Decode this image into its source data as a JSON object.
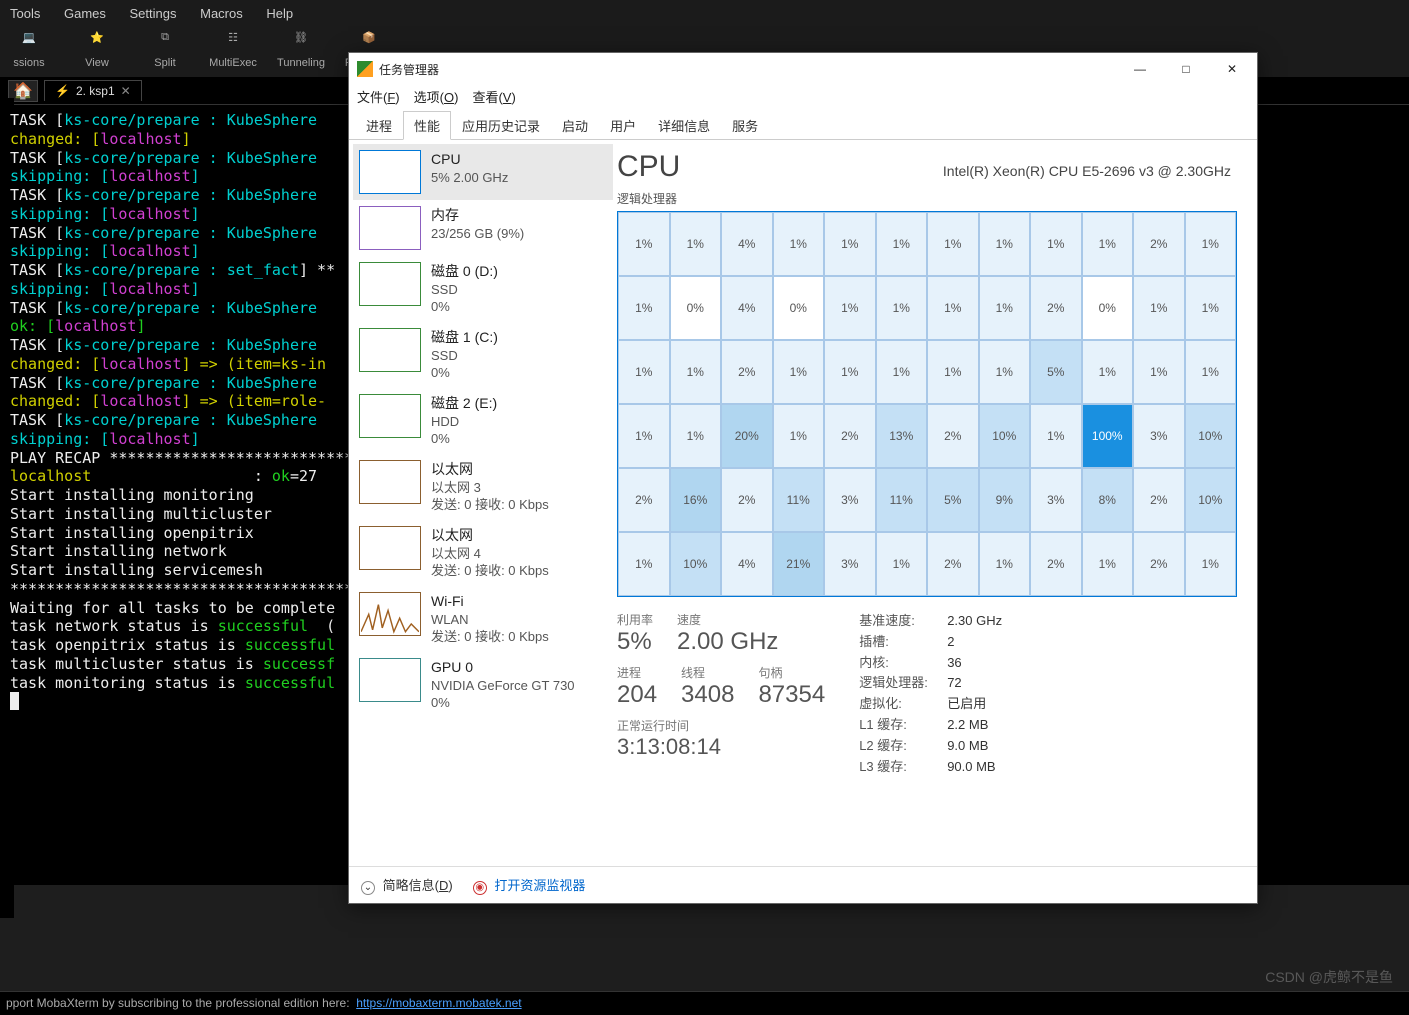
{
  "moba": {
    "menus": [
      "Tools",
      "Games",
      "Settings",
      "Macros",
      "Help"
    ],
    "toolbar": [
      "ssions",
      "View",
      "Split",
      "MultiExec",
      "Tunneling",
      "Packages"
    ],
    "tab": {
      "label": "2. ksp1"
    },
    "terminal_lines": [
      {
        "segs": [
          [
            "",
            ""
          ]
        ]
      },
      {
        "segs": [
          [
            "white",
            "TASK ["
          ],
          [
            "cyan",
            "ks-core/prepare : KubeSphere"
          ],
          [
            "white",
            ""
          ]
        ]
      },
      {
        "segs": [
          [
            "yellow",
            "changed: ["
          ],
          [
            "magenta",
            "localhost"
          ],
          [
            "yellow",
            "]"
          ]
        ]
      },
      {
        "segs": [
          [
            "",
            ""
          ]
        ]
      },
      {
        "segs": [
          [
            "white",
            "TASK ["
          ],
          [
            "cyan",
            "ks-core/prepare : KubeSphere"
          ],
          [
            "white",
            ""
          ]
        ]
      },
      {
        "segs": [
          [
            "cyan",
            "skipping: ["
          ],
          [
            "magenta",
            "localhost"
          ],
          [
            "cyan",
            "]"
          ]
        ]
      },
      {
        "segs": [
          [
            "",
            ""
          ]
        ]
      },
      {
        "segs": [
          [
            "white",
            "TASK ["
          ],
          [
            "cyan",
            "ks-core/prepare : KubeSphere"
          ],
          [
            "white",
            ""
          ]
        ]
      },
      {
        "segs": [
          [
            "cyan",
            "skipping: ["
          ],
          [
            "magenta",
            "localhost"
          ],
          [
            "cyan",
            "]"
          ]
        ]
      },
      {
        "segs": [
          [
            "",
            ""
          ]
        ]
      },
      {
        "segs": [
          [
            "white",
            "TASK ["
          ],
          [
            "cyan",
            "ks-core/prepare : KubeSphere"
          ],
          [
            "white",
            ""
          ]
        ]
      },
      {
        "segs": [
          [
            "cyan",
            "skipping: ["
          ],
          [
            "magenta",
            "localhost"
          ],
          [
            "cyan",
            "]"
          ]
        ]
      },
      {
        "segs": [
          [
            "",
            ""
          ]
        ]
      },
      {
        "segs": [
          [
            "white",
            "TASK ["
          ],
          [
            "cyan",
            "ks-core/prepare : set_fact"
          ],
          [
            "white",
            "] **"
          ]
        ]
      },
      {
        "segs": [
          [
            "cyan",
            "skipping: ["
          ],
          [
            "magenta",
            "localhost"
          ],
          [
            "cyan",
            "]"
          ]
        ]
      },
      {
        "segs": [
          [
            "",
            ""
          ]
        ]
      },
      {
        "segs": [
          [
            "white",
            "TASK ["
          ],
          [
            "cyan",
            "ks-core/prepare : KubeSphere"
          ],
          [
            "white",
            ""
          ]
        ]
      },
      {
        "segs": [
          [
            "green",
            "ok: ["
          ],
          [
            "magenta",
            "localhost"
          ],
          [
            "green",
            "]"
          ]
        ]
      },
      {
        "segs": [
          [
            "",
            ""
          ]
        ]
      },
      {
        "segs": [
          [
            "white",
            "TASK ["
          ],
          [
            "cyan",
            "ks-core/prepare : KubeSphere"
          ],
          [
            "white",
            ""
          ]
        ]
      },
      {
        "segs": [
          [
            "yellow",
            "changed: ["
          ],
          [
            "magenta",
            "localhost"
          ],
          [
            "yellow",
            "] => (item=ks-in"
          ]
        ]
      },
      {
        "segs": [
          [
            "",
            ""
          ]
        ]
      },
      {
        "segs": [
          [
            "white",
            "TASK ["
          ],
          [
            "cyan",
            "ks-core/prepare : KubeSphere"
          ],
          [
            "white",
            ""
          ]
        ]
      },
      {
        "segs": [
          [
            "yellow",
            "changed: ["
          ],
          [
            "magenta",
            "localhost"
          ],
          [
            "yellow",
            "] => (item=role-"
          ]
        ]
      },
      {
        "segs": [
          [
            "",
            ""
          ]
        ]
      },
      {
        "segs": [
          [
            "white",
            "TASK ["
          ],
          [
            "cyan",
            "ks-core/prepare : KubeSphere"
          ],
          [
            "white",
            ""
          ]
        ]
      },
      {
        "segs": [
          [
            "cyan",
            "skipping: ["
          ],
          [
            "magenta",
            "localhost"
          ],
          [
            "cyan",
            "]"
          ]
        ]
      },
      {
        "segs": [
          [
            "",
            ""
          ]
        ]
      },
      {
        "segs": [
          [
            "white",
            "PLAY RECAP *****************************"
          ]
        ]
      },
      {
        "segs": [
          [
            "yellow",
            "localhost"
          ],
          [
            "white",
            "                  : "
          ],
          [
            "green",
            "ok"
          ],
          [
            "white",
            "=27"
          ]
        ]
      },
      {
        "segs": [
          [
            "white",
            "Start installing monitoring"
          ]
        ]
      },
      {
        "segs": [
          [
            "white",
            "Start installing multicluster"
          ]
        ]
      },
      {
        "segs": [
          [
            "white",
            "Start installing openpitrix"
          ]
        ]
      },
      {
        "segs": [
          [
            "white",
            "Start installing network"
          ]
        ]
      },
      {
        "segs": [
          [
            "white",
            "Start installing servicemesh"
          ]
        ]
      },
      {
        "segs": [
          [
            "white",
            "****************************************"
          ]
        ]
      },
      {
        "segs": [
          [
            "white",
            "Waiting for all tasks to be complete"
          ]
        ]
      },
      {
        "segs": [
          [
            "white",
            "task network status is "
          ],
          [
            "green",
            "successful"
          ],
          [
            "white",
            "  ("
          ]
        ]
      },
      {
        "segs": [
          [
            "white",
            "task openpitrix status is "
          ],
          [
            "green",
            "successful"
          ]
        ]
      },
      {
        "segs": [
          [
            "white",
            "task multicluster status is "
          ],
          [
            "green",
            "successf"
          ]
        ]
      },
      {
        "segs": [
          [
            "white",
            "task monitoring status is "
          ],
          [
            "green",
            "successful"
          ]
        ]
      }
    ],
    "statusbar_text": "pport MobaXterm by subscribing to the professional edition here:",
    "statusbar_link": "https://mobaxterm.mobatek.net"
  },
  "tm": {
    "title": "任务管理器",
    "winbtns": {
      "min": "—",
      "max": "□",
      "close": "✕"
    },
    "menus": [
      {
        "label": "文件",
        "hotkey": "F"
      },
      {
        "label": "选项",
        "hotkey": "O"
      },
      {
        "label": "查看",
        "hotkey": "V"
      }
    ],
    "tabs": [
      "进程",
      "性能",
      "应用历史记录",
      "启动",
      "用户",
      "详细信息",
      "服务"
    ],
    "active_tab": 1,
    "sidebar": [
      {
        "kind": "cpu",
        "title": "CPU",
        "sub": "5% 2.00 GHz",
        "active": true
      },
      {
        "kind": "mem",
        "title": "内存",
        "sub": "23/256 GB (9%)"
      },
      {
        "kind": "disk",
        "title": "磁盘 0 (D:)",
        "sub": "SSD",
        "sub2": "0%"
      },
      {
        "kind": "disk",
        "title": "磁盘 1 (C:)",
        "sub": "SSD",
        "sub2": "0%"
      },
      {
        "kind": "disk",
        "title": "磁盘 2 (E:)",
        "sub": "HDD",
        "sub2": "0%"
      },
      {
        "kind": "net",
        "title": "以太网",
        "sub": "以太网 3",
        "sub2": "发送: 0 接收: 0 Kbps"
      },
      {
        "kind": "net",
        "title": "以太网",
        "sub": "以太网 4",
        "sub2": "发送: 0 接收: 0 Kbps"
      },
      {
        "kind": "wifi",
        "title": "Wi-Fi",
        "sub": "WLAN",
        "sub2": "发送: 0 接收: 0 Kbps"
      },
      {
        "kind": "gpu",
        "title": "GPU 0",
        "sub": "NVIDIA GeForce GT 730",
        "sub2": "0%"
      }
    ],
    "main": {
      "heading": "CPU",
      "model": "Intel(R) Xeon(R) CPU E5-2696 v3 @ 2.30GHz",
      "subheader": "逻辑处理器",
      "cells": [
        [
          "1%",
          "1%",
          "4%",
          "1%",
          "1%",
          "1%",
          "1%",
          "1%",
          "1%",
          "1%",
          "2%",
          "1%"
        ],
        [
          "1%",
          "0%",
          "4%",
          "0%",
          "1%",
          "1%",
          "1%",
          "1%",
          "2%",
          "0%",
          "1%",
          "1%"
        ],
        [
          "1%",
          "1%",
          "2%",
          "1%",
          "1%",
          "1%",
          "1%",
          "1%",
          "5%",
          "1%",
          "1%",
          "1%"
        ],
        [
          "1%",
          "1%",
          "20%",
          "1%",
          "2%",
          "13%",
          "2%",
          "10%",
          "1%",
          "100%",
          "3%",
          "10%"
        ],
        [
          "2%",
          "16%",
          "2%",
          "11%",
          "3%",
          "11%",
          "5%",
          "9%",
          "3%",
          "8%",
          "2%",
          "10%"
        ],
        [
          "1%",
          "10%",
          "4%",
          "21%",
          "3%",
          "1%",
          "2%",
          "1%",
          "2%",
          "1%",
          "2%",
          "1%"
        ]
      ],
      "stats_left": [
        {
          "label": "利用率",
          "value": "5%"
        },
        {
          "label": "速度",
          "value": "2.00 GHz"
        }
      ],
      "stats_row2": [
        {
          "label": "进程",
          "value": "204"
        },
        {
          "label": "线程",
          "value": "3408"
        },
        {
          "label": "句柄",
          "value": "87354"
        }
      ],
      "uptime_label": "正常运行时间",
      "uptime_value": "3:13:08:14",
      "info": [
        {
          "k": "基准速度:",
          "v": "2.30 GHz"
        },
        {
          "k": "插槽:",
          "v": "2"
        },
        {
          "k": "内核:",
          "v": "36"
        },
        {
          "k": "逻辑处理器:",
          "v": "72"
        },
        {
          "k": "虚拟化:",
          "v": "已启用"
        },
        {
          "k": "L1 缓存:",
          "v": "2.2 MB"
        },
        {
          "k": "L2 缓存:",
          "v": "9.0 MB"
        },
        {
          "k": "L3 缓存:",
          "v": "90.0 MB"
        }
      ]
    },
    "footer": {
      "brief": "简略信息",
      "brief_hotkey": "D",
      "open_monitor": "打开资源监视器"
    }
  },
  "watermark": "CSDN @虎鲸不是鱼"
}
